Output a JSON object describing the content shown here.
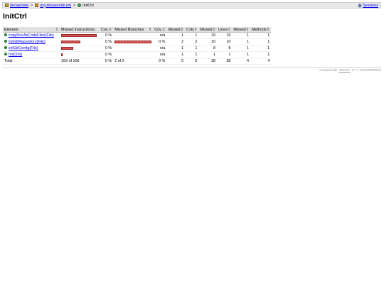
{
  "breadcrumb": {
    "items": [
      {
        "label": "docascode",
        "icon": "report-icon"
      },
      {
        "label": "org.docascode.init",
        "icon": "package-icon"
      }
    ],
    "current": {
      "label": "InitCtrl",
      "icon": "class-icon"
    },
    "separator": ">",
    "sessions_label": "Sessions"
  },
  "page_title": "InitCtrl",
  "table": {
    "headers": {
      "element": "Element",
      "missed_instructions": "Missed Instructions",
      "cov1": "Cov.",
      "missed_branches": "Missed Branches",
      "cov2": "Cov.",
      "missed1": "Missed",
      "cxty": "Cxty",
      "missed2": "Missed",
      "lines": "Lines",
      "missed3": "Missed",
      "methods": "Methods"
    },
    "sort_indicator": "↓",
    "rows": [
      {
        "element": "copyDocAsCodeFiles(File)",
        "instr_ratio": 1.0,
        "cov1": "0 %",
        "branch_ratio": 0,
        "cov2": "n/a",
        "m1": "1",
        "cxty": "1",
        "m2": "19",
        "lines": "19",
        "m3": "1",
        "methods": "1"
      },
      {
        "element": "initGitRepository(File)",
        "instr_ratio": 0.54,
        "cov1": "0 %",
        "branch_ratio": 1.0,
        "cov2": "0 %",
        "m1": "2",
        "cxty": "2",
        "m2": "10",
        "lines": "10",
        "m3": "1",
        "methods": "1"
      },
      {
        "element": "initGitConfig(File)",
        "instr_ratio": 0.34,
        "cov1": "0 %",
        "branch_ratio": 0,
        "cov2": "n/a",
        "m1": "1",
        "cxty": "1",
        "m2": "8",
        "lines": "8",
        "m3": "1",
        "methods": "1"
      },
      {
        "element": "InitCtrl()",
        "instr_ratio": 0.02,
        "cov1": "0 %",
        "branch_ratio": 0,
        "cov2": "n/a",
        "m1": "1",
        "cxty": "1",
        "m2": "1",
        "lines": "1",
        "m3": "1",
        "methods": "1"
      }
    ],
    "total": {
      "label": "Total",
      "instr": "169 of 169",
      "cov1": "0 %",
      "branch": "2 of 2",
      "cov2": "0 %",
      "m1": "5",
      "cxty": "5",
      "m2": "38",
      "lines": "38",
      "m3": "4",
      "methods": "4"
    }
  },
  "footer": {
    "prefix": "Created with",
    "link": "JaCoCo",
    "version": "0.7.7.201606060606"
  },
  "colors": {
    "bar": "#d85050",
    "header_bg": "#e0e0e0",
    "breadcrumb_bg": "#e8e8e8"
  }
}
